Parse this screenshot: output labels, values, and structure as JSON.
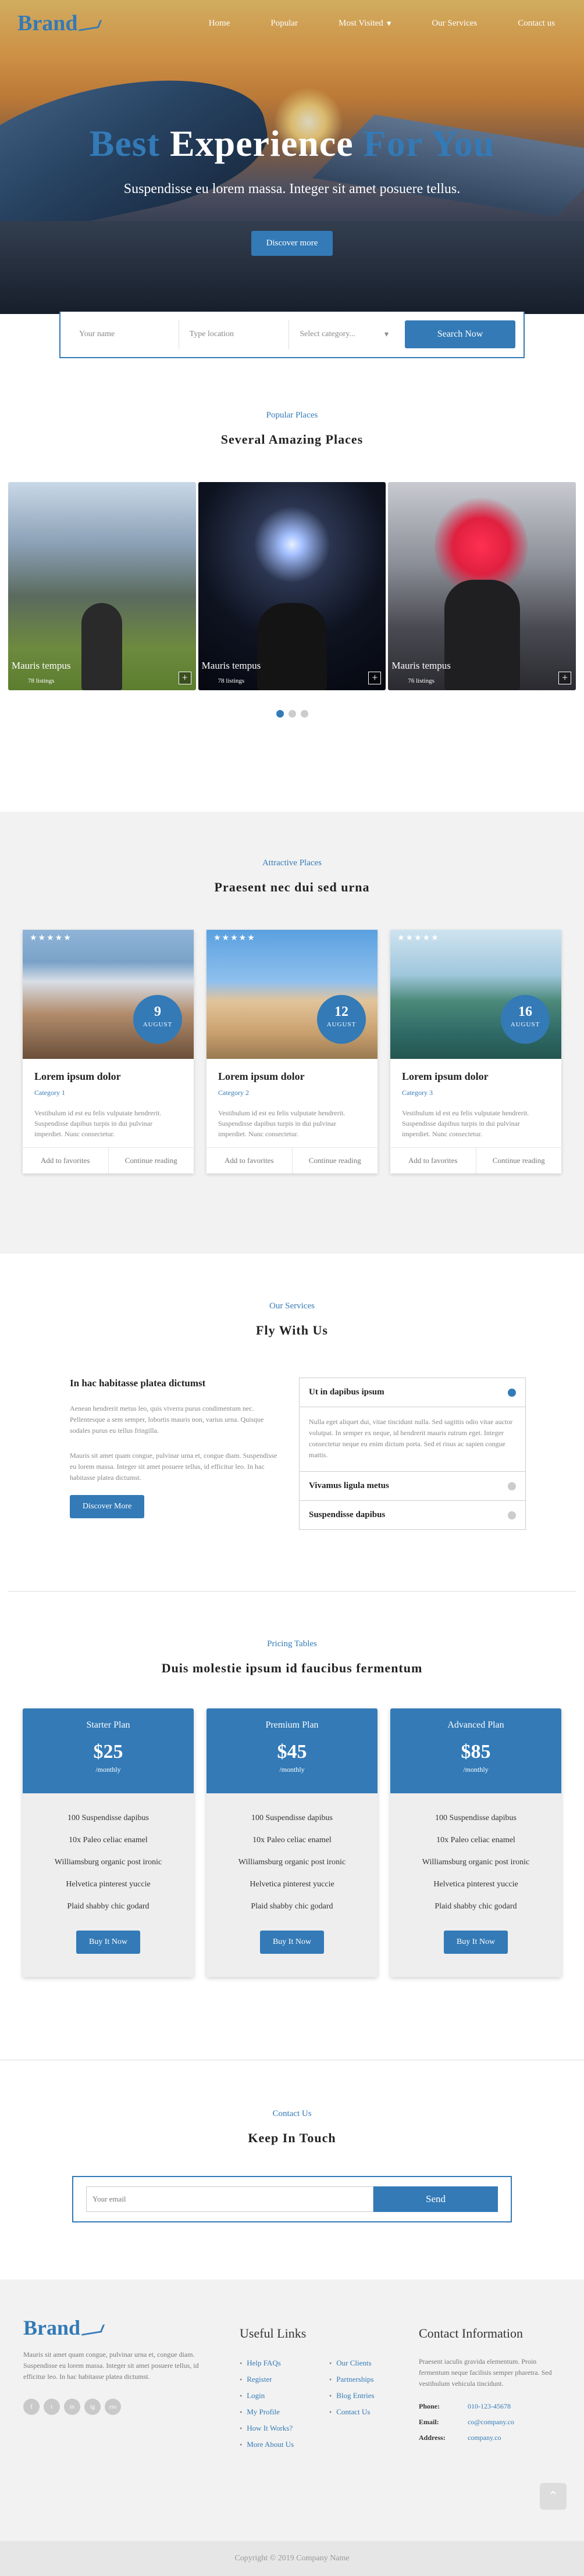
{
  "nav": {
    "brand": "Brand",
    "links": [
      "Home",
      "Popular",
      "Most Visited",
      "Our Services",
      "Contact us"
    ],
    "dropdown_caret": "▾"
  },
  "hero": {
    "title_a": "Best",
    "title_b": "Experience",
    "title_c": "For You",
    "subtitle": "Suspendisse eu lorem massa. Integer sit amet posuere tellus.",
    "button": "Discover more"
  },
  "search": {
    "name_placeholder": "Your name",
    "location_placeholder": "Type location",
    "category_placeholder": "Select category...",
    "caret": "▾",
    "button": "Search Now"
  },
  "popular": {
    "label": "Popular Places",
    "title": "Several Amazing Places",
    "slides": [
      {
        "name": "Mauris tempus",
        "count": "78 listings"
      },
      {
        "name": "Mauris tempus",
        "count": "78 listings"
      },
      {
        "name": "Mauris tempus",
        "count": "76 listings"
      }
    ],
    "plus": "+"
  },
  "attractive": {
    "label": "Attractive Places",
    "title": "Praesent nec dui sed urna",
    "cards": [
      {
        "stars": "★★★★★",
        "day": "9",
        "month": "AUGUST",
        "title": "Lorem ipsum dolor",
        "category": "Category 1",
        "text": "Vestibulum id est eu felis vulputate hendrerit. Suspendisse dapibus turpis in dui pulvinar imperdiet. Nunc consectetur.",
        "fav": "Add to favorites",
        "more": "Continue reading"
      },
      {
        "stars": "★★★★★",
        "day": "12",
        "month": "AUGUST",
        "title": "Lorem ipsum dolor",
        "category": "Category 2",
        "text": "Vestibulum id est eu felis vulputate hendrerit. Suspendisse dapibus turpis in dui pulvinar imperdiet. Nunc consectetur.",
        "fav": "Add to favorites",
        "more": "Continue reading"
      },
      {
        "stars": "★★★★★",
        "day": "16",
        "month": "AUGUST",
        "title": "Lorem ipsum dolor",
        "category": "Category 3",
        "text": "Vestibulum id est eu felis vulputate hendrerit. Suspendisse dapibus turpis in dui pulvinar imperdiet. Nunc consectetur.",
        "fav": "Add to favorites",
        "more": "Continue reading"
      }
    ]
  },
  "services": {
    "label": "Our Services",
    "title": "Fly With Us",
    "heading": "In hac habitasse platea dictumst",
    "para1": "Aenean hendrerit metus leo, quis viverra purus condimentum nec. Pellentesque a sem semper, lobortis mauris non, varius urna. Quisque sodales purus eu tellus fringilla.",
    "para2": "Mauris sit amet quam congue, pulvinar urna et, congue diam. Suspendisse eu lorem massa. Integer sit amet posuere tellus, id efficitur leo. In hac habitasse platea dictumst.",
    "button": "Discover More",
    "accordion": [
      {
        "title": "Ut in dapibus ipsum",
        "body": "Nulla eget aliquet dui, vitae tincidunt nulla. Sed sagittis odio vitae auctor volutpat. In semper ex neque, id hendrerit mauris rutrum eget. Integer consectetur neque eu enim dictum porta. Sed et risus ac sapien congue mattis."
      },
      {
        "title": "Vivamus ligula metus",
        "body": ""
      },
      {
        "title": "Suspendisse dapibus",
        "body": ""
      }
    ]
  },
  "pricing": {
    "label": "Pricing Tables",
    "title": "Duis molestie ipsum id faucibus fermentum",
    "plans": [
      {
        "name": "Starter Plan",
        "price": "$25",
        "per": "/monthly",
        "features": [
          "100 Suspendisse dapibus",
          "10x Paleo celiac enamel",
          "Williamsburg organic post ironic",
          "Helvetica pinterest yuccie",
          "Plaid shabby chic godard"
        ],
        "button": "Buy It Now"
      },
      {
        "name": "Premium Plan",
        "price": "$45",
        "per": "/monthly",
        "features": [
          "100 Suspendisse dapibus",
          "10x Paleo celiac enamel",
          "Williamsburg organic post ironic",
          "Helvetica pinterest yuccie",
          "Plaid shabby chic godard"
        ],
        "button": "Buy It Now"
      },
      {
        "name": "Advanced Plan",
        "price": "$85",
        "per": "/monthly",
        "features": [
          "100 Suspendisse dapibus",
          "10x Paleo celiac enamel",
          "Williamsburg organic post ironic",
          "Helvetica pinterest yuccie",
          "Plaid shabby chic godard"
        ],
        "button": "Buy It Now"
      }
    ]
  },
  "contact": {
    "label": "Contact Us",
    "title": "Keep In Touch",
    "email_placeholder": "Your email",
    "button": "Send"
  },
  "footer": {
    "brand": "Brand",
    "about": "Mauris sit amet quam congue, pulvinar urna et, congue diam. Suspendisse eu lorem massa. Integer sit amet posuere tellus, id efficitur leo. In hac habitasse platea dictumst.",
    "socials": [
      "f",
      "t",
      "in",
      "ig",
      "rss"
    ],
    "links_title": "Useful Links",
    "links_a": [
      "Help FAQs",
      "Register",
      "Login",
      "My Profile",
      "How It Works?",
      "More About Us"
    ],
    "links_b": [
      "Our Clients",
      "Partnerships",
      "Blog Entries",
      "Contact Us"
    ],
    "info_title": "Contact Information",
    "info_text": "Praesent iaculis gravida elementum. Proin fermentum neque facilisis semper pharetra. Sed vestibulum vehicula tincidunt.",
    "phone_label": "Phone:",
    "phone": "010-123-45678",
    "email_label": "Email:",
    "email": "co@company.co",
    "address_label": "Address:",
    "address": "company.co",
    "top_icon": "⌃",
    "copyright": "Copyright © 2019 Company Name"
  },
  "colors": {
    "accent": "#337ab7",
    "light_bg": "#f2f2f2"
  }
}
